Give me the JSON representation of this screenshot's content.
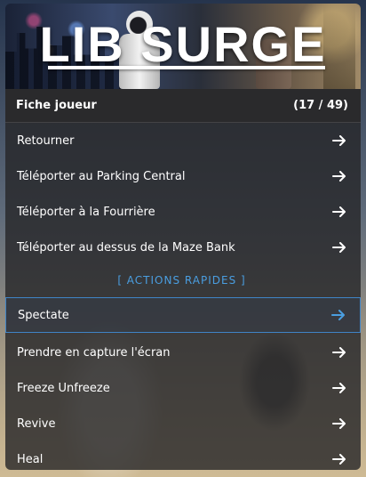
{
  "banner": {
    "title": "LIB SURGE"
  },
  "header": {
    "title": "Fiche joueur",
    "page_counter": "(17 / 49)"
  },
  "items": [
    {
      "label": "Retourner",
      "icon": "arrow-right-icon"
    },
    {
      "label": "Téléporter au Parking Central",
      "icon": "arrow-right-icon"
    },
    {
      "label": "Téléporter à la Fourrière",
      "icon": "arrow-right-icon"
    },
    {
      "label": "Téléporter au dessus de la Maze Bank",
      "icon": "arrow-right-icon"
    }
  ],
  "section": {
    "label": "[ ACTIONS RAPIDES ]"
  },
  "quick_actions": [
    {
      "label": "Spectate",
      "icon": "arrow-right-icon",
      "selected": true
    },
    {
      "label": "Prendre en capture l'écran",
      "icon": "arrow-right-icon"
    },
    {
      "label": "Freeze Unfreeze",
      "icon": "arrow-right-icon"
    },
    {
      "label": "Revive",
      "icon": "arrow-right-icon"
    },
    {
      "label": "Heal",
      "icon": "arrow-right-icon"
    }
  ],
  "colors": {
    "accent": "#4a9ee0",
    "selected_border": "#3f84c6",
    "panel": "#262628"
  }
}
